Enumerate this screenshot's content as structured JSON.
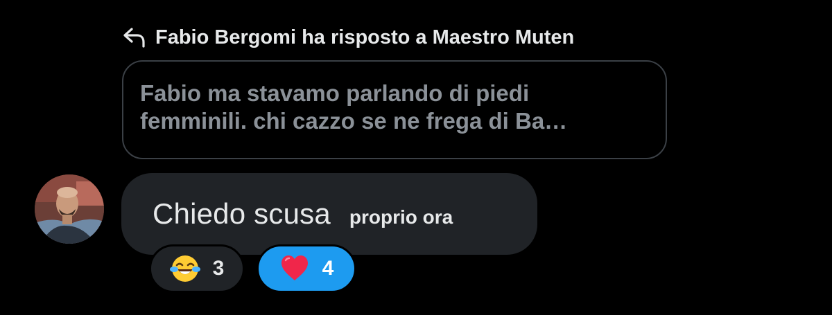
{
  "reply_header": {
    "text": "Fabio Bergomi ha risposto a Maestro Muten",
    "icon": "reply-arrow-icon"
  },
  "quoted_message": {
    "line1": "Fabio ma stavamo parlando di piedi",
    "line2": "femminili. chi cazzo se ne frega di Ba…"
  },
  "message": {
    "text": "Chiedo scusa",
    "time": "proprio ora",
    "avatar": "user-avatar"
  },
  "reactions": [
    {
      "emoji": "tears-of-joy-emoji",
      "count": "3",
      "selected": false
    },
    {
      "emoji": "red-heart-emoji",
      "count": "4",
      "selected": true
    }
  ],
  "colors": {
    "background": "#000000",
    "bubble": "#202327",
    "quote_border": "#3b4046",
    "quote_text": "#8b9198",
    "accent": "#1d9bf0"
  }
}
